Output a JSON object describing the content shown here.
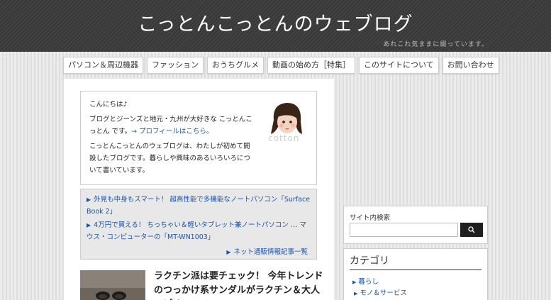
{
  "header": {
    "site_title": "こっとんこっとんのウェブログ",
    "tagline": "あれこれ気ままに綴っています。"
  },
  "nav": {
    "items": [
      "パソコン＆周辺機器",
      "ファッション",
      "おうちグルメ",
      "動画の始め方［特集］",
      "このサイトについて",
      "お問い合わせ"
    ]
  },
  "intro": {
    "greeting": "こんにちは♪",
    "line1": "ブログとジーンズと地元・九州が大好きな こっとんこっとん です。",
    "profile_link": "→ プロフィールはこちら。",
    "line2": "こっとんこっとんのウェブログは、わたしが初めて開設したブログです。暮らしや興味のあるいろいろについて書いています。",
    "avatar_icon": "avatar-illustration-icon",
    "avatar_text": "cotton"
  },
  "news": {
    "items": [
      "外見も中身もスマート！ 超高性能で多機能なノートパソコン「Surface Book 2」",
      "4万円で買える！ ちっちゃい＆軽いタブレット兼ノートパソコン … マウス・コンピューターの「MT-WN1003」"
    ],
    "more_label": "ネット通販情報記事一覧"
  },
  "article": {
    "title": "ラクチン派は要チェック！ 今年トレンドのつっかけ系サンダルがラクチン＆大人っぽくてイイ♪"
  },
  "sidebar": {
    "search_title": "サイト内検索",
    "search_value": "",
    "search_icon": "search-icon",
    "category_title": "カテゴリ",
    "categories": [
      "暮らし",
      "モノ＆サービス"
    ]
  }
}
